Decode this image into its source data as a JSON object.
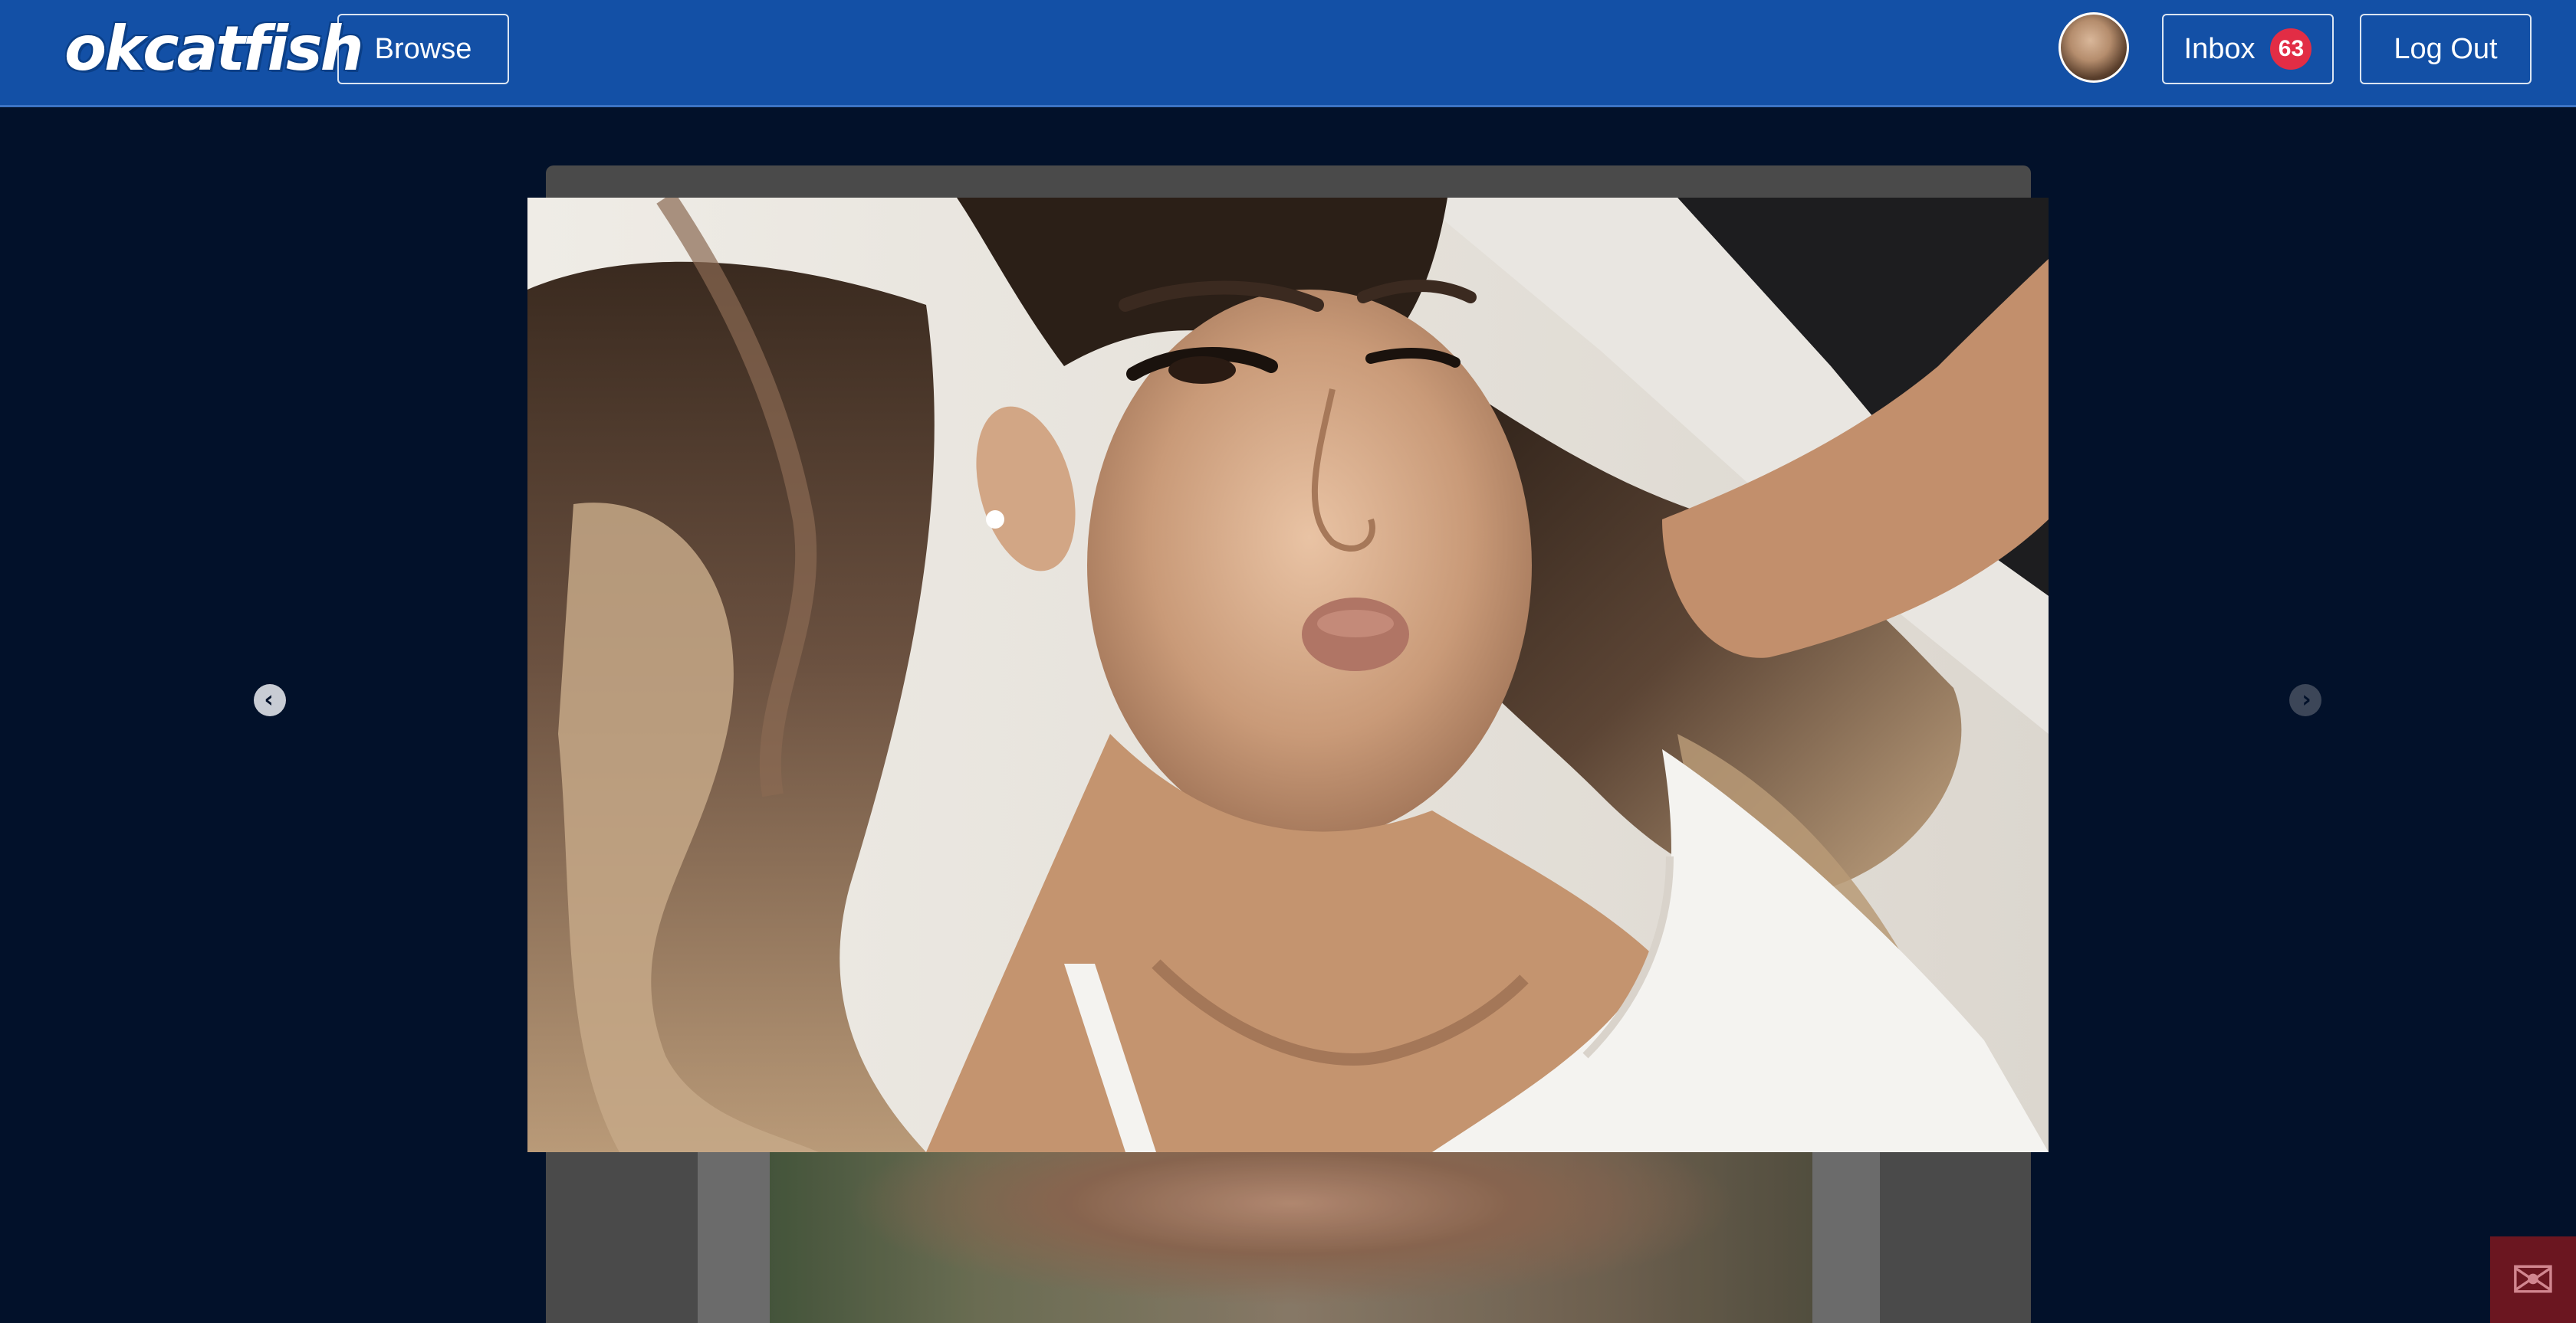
{
  "header": {
    "logo_text": "okcatfish",
    "browse_label": "Browse",
    "inbox_label": "Inbox",
    "inbox_count": "63",
    "logout_label": "Log Out"
  },
  "icons": {
    "prev": "chevron-left-circle-icon",
    "next": "chevron-right-circle-icon",
    "mail": "envelope-icon",
    "avatar": "user-avatar"
  },
  "colors": {
    "header_bg": "#1350a6",
    "page_bg": "#02112a",
    "badge_bg": "#e22d45",
    "mail_button_bg": "#6b1620"
  },
  "lightbox": {
    "photo_alt": ""
  }
}
